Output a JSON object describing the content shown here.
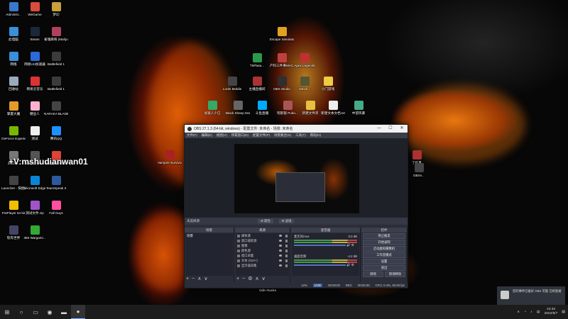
{
  "desktop": {
    "icons": [
      {
        "label": "Administ...",
        "color": "#3a78c9"
      },
      {
        "label": "WeGame",
        "color": "#d94b3b"
      },
      {
        "label": "梦幻",
        "color": "#c9a03a"
      },
      {
        "label": "此电脑",
        "color": "#3a8fd9"
      },
      {
        "label": "Steam",
        "color": "#1b2838"
      },
      {
        "label": "雀魂麻将 (Mahjong...",
        "color": "#b0405e"
      },
      {
        "label": "网络",
        "color": "#3a8fd9"
      },
      {
        "label": "网易UU加速器",
        "color": "#2a6ad9"
      },
      {
        "label": "Battlefield 1",
        "color": "#3b3b3b"
      },
      {
        "label": "回收站",
        "color": "#9ab"
      },
      {
        "label": "网易云音乐",
        "color": "#d33"
      },
      {
        "label": "Battlefield 1",
        "color": "#3b3b3b"
      },
      {
        "label": "掌握大魔",
        "color": "#e39a2a"
      },
      {
        "label": "糖豆人",
        "color": "#ffb0d0"
      },
      {
        "label": "NARAKA BLADEPOI...",
        "color": "#444"
      },
      {
        "label": "GeForce Experience",
        "color": "#76b900"
      },
      {
        "label": "测试",
        "color": "#eee"
      },
      {
        "label": "腾讯QQ",
        "color": "#1e90ff"
      },
      {
        "label": "20220...",
        "color": "#777"
      },
      {
        "label": "CBT (Clos...",
        "color": "#555"
      },
      {
        "label": "Google Chrome",
        "color": "#db4437"
      },
      {
        "label": "Launcher - 快捷方式",
        "color": "#444"
      },
      {
        "label": "Microsoft Edge",
        "color": "#0a84d6"
      },
      {
        "label": "TeamSpeak 3",
        "color": "#2c5aa0"
      },
      {
        "label": "PotPlayer 64 bit",
        "color": "#f0c000"
      },
      {
        "label": "测试文件.zip",
        "color": "#a054c9"
      },
      {
        "label": "Fall Guys",
        "color": "#ff4fa0"
      },
      {
        "label": "现有世界",
        "color": "#446"
      },
      {
        "label": "360 Wargami...",
        "color": "#3a3"
      }
    ],
    "center_icons": [
      {
        "label": "Escape Simulator",
        "color": "#e0a020"
      },
      {
        "label": "TMTasa...",
        "color": "#2a9a4a"
      },
      {
        "label": "产科三件事MAC...",
        "color": "#c04040"
      },
      {
        "label": "Apex Legends",
        "color": "#c03030"
      },
      {
        "label": "Lords Mobile",
        "color": "#444"
      },
      {
        "label": "主播直播间",
        "color": "#a33"
      },
      {
        "label": "OBS Studio",
        "color": "#302e31"
      },
      {
        "label": "Vanch...",
        "color": "#553"
      },
      {
        "label": "小门游戏",
        "color": "#ec4"
      },
      {
        "label": "加速人少已",
        "color": "#3a6"
      },
      {
        "label": "Black Sheep Demo",
        "color": "#666"
      },
      {
        "label": "斗鱼直播",
        "color": "#0af"
      },
      {
        "label": "暗影狼 Pubo...",
        "color": "#a55"
      },
      {
        "label": "新建文件夹",
        "color": "#e8c040"
      },
      {
        "label": "新建文本文档.txt",
        "color": "#eee"
      },
      {
        "label": "中望风暴",
        "color": "#4a8"
      },
      {
        "label": "Vampire Survivors",
        "color": "#a22"
      },
      {
        "label": "Odin Ranks",
        "color": "#555"
      }
    ],
    "right_icons": [
      {
        "label": "了红月",
        "color": "#a33"
      },
      {
        "label": "GBXn...",
        "color": "#444"
      }
    ],
    "watermark": "+V:mshudianwan01"
  },
  "obs": {
    "title": "OBS 27.1.3 (64-bit, windows) - 配置文件: 未命名 - 场景: 未命名",
    "title_controls": [
      "—",
      "☐",
      "✕"
    ],
    "menu": [
      "文件(F)",
      "编辑(E)",
      "视图(V)",
      "停靠窗口(D)",
      "配置文件(P)",
      "场景集合(S)",
      "工具(T)",
      "帮助(H)"
    ],
    "source_bar": {
      "label": "未选择源",
      "properties_btn": "⚙ 属性",
      "filters_btn": "⚙ 滤镜"
    },
    "docks": {
      "scenes": {
        "title": "场景",
        "items": [
          "场景"
        ]
      },
      "sources": {
        "title": "来源",
        "items": [
          "媒体源",
          "窗口捕获源",
          "图像",
          "颜色源",
          "窗口采集",
          "文本 (GDI+)",
          "显示器采集"
        ]
      },
      "mixer": {
        "title": "混音器",
        "channels": [
          {
            "name": "麦克风/Aux",
            "db": "0.0 dB"
          },
          {
            "name": "桌面音频",
            "db": "-4.2 dB"
          }
        ]
      },
      "controls": {
        "title": "控件",
        "buttons": [
          "停止推流",
          "开始录制",
          "启动虚拟摄像机",
          "工作室模式",
          "设置",
          "退出"
        ],
        "tabs": [
          "转场",
          "转场特效"
        ]
      }
    },
    "footer_icons": [
      "+",
      "−",
      "∧",
      "∨"
    ],
    "status": {
      "live_label": "LIVE",
      "live_time": "00:00:00",
      "rec_label": "REC",
      "rec_time": "00:00:00",
      "cpu": "CPU: 0.4%, 60.00 fps",
      "dropped": "12%"
    }
  },
  "notification": {
    "text": "您的事件已备好 OBS 可能 已经就绪"
  },
  "taskbar": {
    "icons": [
      "windows-start-icon",
      "search-icon",
      "task-view-icon",
      "chrome-icon",
      "folder-icon",
      "obs-icon"
    ],
    "time": "10:33",
    "date": "2022/8/7",
    "tray_lang": "中"
  }
}
